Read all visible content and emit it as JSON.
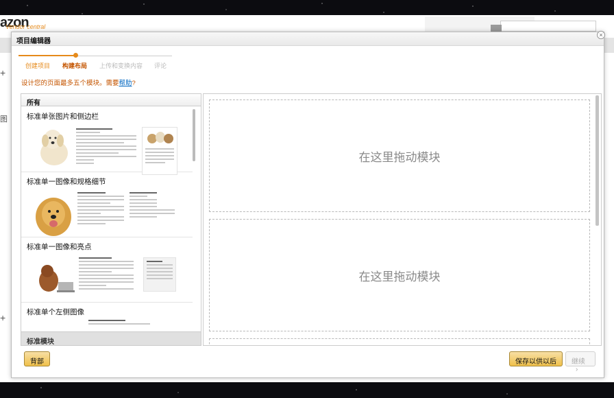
{
  "background_page": {
    "logo": "azon",
    "logo_sub": "Vendor central",
    "side_glyphs": [
      "+",
      "图",
      "+"
    ]
  },
  "modal": {
    "title": "项目编辑器",
    "close_glyph": "×",
    "steps": [
      {
        "label": "创建项目",
        "state": "done"
      },
      {
        "label": "构建布局",
        "state": "active"
      },
      {
        "label": "上传和变换内容",
        "state": "pending"
      },
      {
        "label": "评论",
        "state": "pending"
      }
    ],
    "progress_fraction": 0.37,
    "hint_text": "设计您的页面最多五个模块。需要",
    "hint_link": "帮助",
    "hint_suffix": "?",
    "module_panel": {
      "tab_label": "所有",
      "modules": [
        {
          "name": "标准单张图片和侧边栏"
        },
        {
          "name": "标准单一图像和规格细节"
        },
        {
          "name": "标准单一图像和亮点"
        },
        {
          "name": "标准单个左侧图像"
        }
      ],
      "footer_label": "标准模块"
    },
    "drop_zones": [
      {
        "label": "在这里拖动模块"
      },
      {
        "label": "在这里拖动模块"
      }
    ],
    "buttons": {
      "back": "背部",
      "save_later": "保存以供以后",
      "continue": "继续",
      "continue_arrow": "›"
    }
  },
  "colors": {
    "accent": "#e68a1a",
    "accent_dark": "#c45500",
    "link": "#0066c0",
    "button_yellow": "#f0c14b"
  }
}
